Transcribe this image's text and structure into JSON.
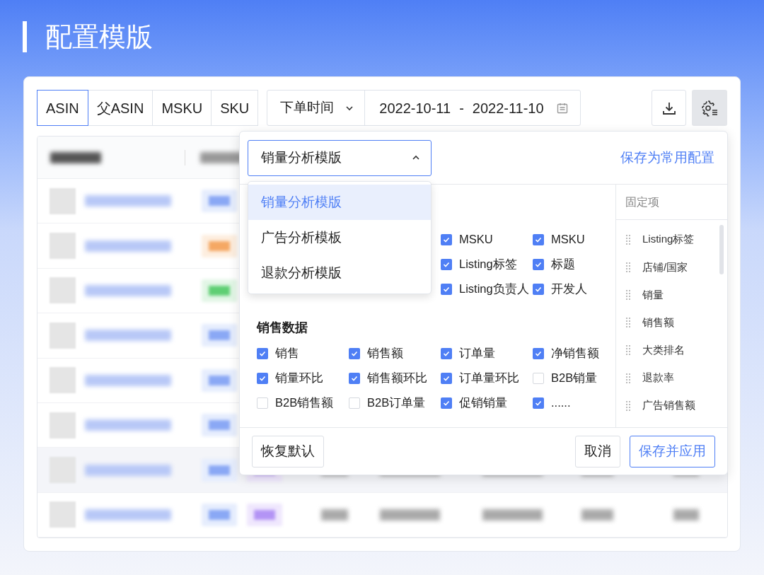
{
  "page_title": "配置模版",
  "id_tabs": [
    {
      "label": "ASIN",
      "selected": true
    },
    {
      "label": "父ASIN",
      "selected": false
    },
    {
      "label": "MSKU",
      "selected": false
    },
    {
      "label": "SKU",
      "selected": false
    }
  ],
  "date_filter": {
    "field": "下单时间",
    "start": "2022-10-11",
    "separator": "-",
    "end": "2022-11-10"
  },
  "config_panel": {
    "template_select": {
      "value": "销量分析模版",
      "expanded": true
    },
    "save_common": "保存为常用配置",
    "template_options": [
      {
        "label": "销量分析模版",
        "selected": true
      },
      {
        "label": "广告分析模板",
        "selected": false
      },
      {
        "label": "退款分析模版",
        "selected": false
      }
    ],
    "groups": [
      {
        "items": [
          {
            "label": "MSKU",
            "checked": true
          },
          {
            "label": "MSKU",
            "checked": true
          },
          {
            "label": "Listing标签",
            "checked": true
          },
          {
            "label": "标题",
            "checked": true
          },
          {
            "label": "Listing负责人",
            "checked": true
          },
          {
            "label": "开发人",
            "checked": true
          }
        ]
      },
      {
        "title": "销售数据",
        "items": [
          {
            "label": "销售",
            "checked": true
          },
          {
            "label": "销售额",
            "checked": true
          },
          {
            "label": "订单量",
            "checked": true
          },
          {
            "label": "净销售额",
            "checked": true
          },
          {
            "label": "销量环比",
            "checked": true
          },
          {
            "label": "销售额环比",
            "checked": true
          },
          {
            "label": "订单量环比",
            "checked": true
          },
          {
            "label": "B2B销量",
            "checked": false
          },
          {
            "label": "B2B销售额",
            "checked": false
          },
          {
            "label": "B2B订单量",
            "checked": false
          },
          {
            "label": "促销销量",
            "checked": true
          },
          {
            "label": "......",
            "checked": true
          }
        ]
      }
    ],
    "pinned": {
      "title": "固定项",
      "items": [
        "Listing标签",
        "店铺/国家",
        "销量",
        "销售额",
        "大类排名",
        "退款率",
        "广告销售额"
      ]
    },
    "buttons": {
      "reset": "恢复默认",
      "cancel": "取消",
      "apply": "保存并应用"
    }
  }
}
